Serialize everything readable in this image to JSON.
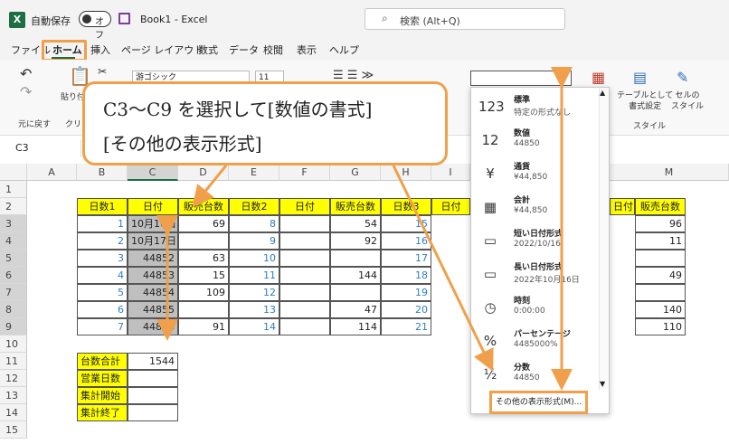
{
  "titlebar": {
    "app_icon_text": "X",
    "autosave_label": "自動保存",
    "autosave_state": "オフ",
    "title": "Book1 - Excel",
    "search_placeholder": "検索 (Alt+Q)"
  },
  "tabs": [
    "ファイル",
    "ホーム",
    "挿入",
    "ページ レイアウト",
    "数式",
    "データ",
    "校閲",
    "表示",
    "ヘルプ"
  ],
  "ribbon": {
    "undo_group": "元に戻す",
    "clipboard_group": "クリッ",
    "paste_label": "貼り付",
    "font_name": "游ゴシック",
    "font_size": "11",
    "table_format_label": "テーブルとして\n書式設定",
    "cell_style_label": "セルの\nスタイル",
    "style_group": "スタイル",
    "partial_label_ki": "き"
  },
  "namebox": "C3",
  "columns": [
    "A",
    "B",
    "C",
    "D",
    "E",
    "F",
    "G",
    "H",
    "I",
    "M"
  ],
  "rows": [
    "1",
    "2",
    "3",
    "4",
    "5",
    "6",
    "7",
    "8",
    "9",
    "10",
    "11",
    "12",
    "13",
    "14",
    "15"
  ],
  "table_headers": [
    "日数1",
    "日付",
    "販売台数",
    "日数2",
    "日付",
    "販売台数",
    "日数3",
    "日付",
    "日付",
    "販売台数"
  ],
  "table_rows": [
    {
      "b": "1",
      "c": "10月16日",
      "d": "69",
      "e": "8",
      "g": "54",
      "h": "15",
      "m": "96"
    },
    {
      "b": "2",
      "c": "10月17日",
      "d": "",
      "e": "9",
      "g": "92",
      "h": "16",
      "m": "11"
    },
    {
      "b": "3",
      "c": "44852",
      "d": "63",
      "e": "10",
      "g": "",
      "h": "17",
      "m": ""
    },
    {
      "b": "4",
      "c": "44853",
      "d": "15",
      "e": "11",
      "g": "144",
      "h": "18",
      "m": "49"
    },
    {
      "b": "5",
      "c": "44854",
      "d": "109",
      "e": "12",
      "g": "",
      "h": "19",
      "m": ""
    },
    {
      "b": "6",
      "c": "44855",
      "d": "",
      "e": "13",
      "g": "47",
      "h": "20",
      "m": "140"
    },
    {
      "b": "7",
      "c": "44856",
      "d": "91",
      "e": "14",
      "g": "114",
      "h": "21",
      "m": "110"
    }
  ],
  "summary": [
    {
      "label": "台数合計",
      "value": "1544"
    },
    {
      "label": "営業日数",
      "value": ""
    },
    {
      "label": "集計開始",
      "value": ""
    },
    {
      "label": "集計終了",
      "value": ""
    }
  ],
  "number_format_menu": [
    {
      "icon": "clock-123-icon",
      "glyph": "123",
      "label": "標準",
      "sample": "特定の形式なし"
    },
    {
      "icon": "number-12-icon",
      "glyph": "12",
      "label": "数値",
      "sample": "44850"
    },
    {
      "icon": "currency-icon",
      "glyph": "¥",
      "label": "通貨",
      "sample": "¥44,850"
    },
    {
      "icon": "accounting-icon",
      "glyph": "▦",
      "label": "会計",
      "sample": " ¥44,850"
    },
    {
      "icon": "short-date-icon",
      "glyph": "▭",
      "label": "短い日付形式",
      "sample": "2022/10/16"
    },
    {
      "icon": "long-date-icon",
      "glyph": "▭",
      "label": "長い日付形式",
      "sample": "2022年10月16日"
    },
    {
      "icon": "time-clock-icon",
      "glyph": "◷",
      "label": "時刻",
      "sample": "0:00:00"
    },
    {
      "icon": "percent-icon",
      "glyph": "%",
      "label": "パーセンテージ",
      "sample": "4485000%"
    },
    {
      "icon": "fraction-icon",
      "glyph": "½",
      "label": "分数",
      "sample": "44850"
    }
  ],
  "more_formats": "その他の表示形式(M)...",
  "callout": {
    "line1": "C3～C9 を選択して[数値の書式]",
    "line2": "[その他の表示形式]"
  },
  "colors": {
    "accent": "#f0a04b",
    "header_fill": "#ffff00",
    "excel_green": "#1d6f42",
    "blue_text": "#2f7fc1"
  }
}
